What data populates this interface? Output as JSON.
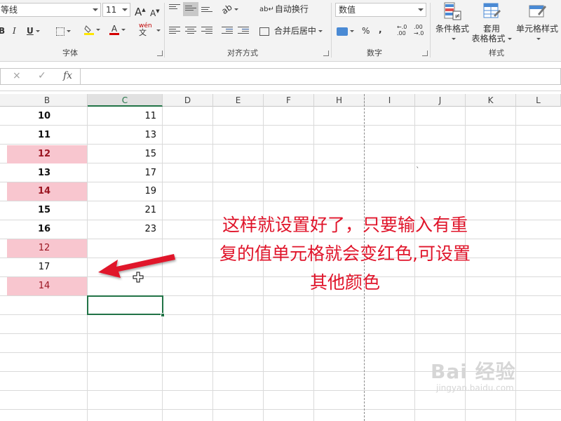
{
  "ribbon": {
    "font_group": {
      "font_name": "等线",
      "font_size": "11",
      "grow_label": "A",
      "shrink_label": "A",
      "bold_label": "B",
      "italic_label": "I",
      "underline_label": "U",
      "phonetic_label": "wén",
      "font_color_label": "A",
      "group_label": "字体"
    },
    "align_group": {
      "wrap_text_label": "自动换行",
      "merge_center_label": "合并后居中",
      "group_label": "对齐方式"
    },
    "number_group": {
      "format_value": "数值",
      "percent_label": "%",
      "comma_label": ",",
      "increase_decimal_label": "←.0 .00",
      "decrease_decimal_label": ".00 →.0",
      "group_label": "数字"
    },
    "styles_group": {
      "conditional_format_label": "条件格式",
      "table_format_label_1": "套用",
      "table_format_label_2": "表格格式",
      "cell_styles_label": "单元格样式",
      "group_label": "样式"
    }
  },
  "formula_bar": {
    "cancel_icon": "×",
    "enter_icon": "✓",
    "fx_label": "fx",
    "value": ""
  },
  "columns": [
    "B",
    "C",
    "D",
    "E",
    "F",
    "H",
    "I",
    "J",
    "K",
    "L"
  ],
  "selected_column": "C",
  "rows": [
    {
      "b": "10",
      "c": "11",
      "b_bold": true,
      "b_pink": false
    },
    {
      "b": "11",
      "c": "13",
      "b_bold": true,
      "b_pink": false
    },
    {
      "b": "12",
      "c": "15",
      "b_bold": true,
      "b_pink": true
    },
    {
      "b": "13",
      "c": "17",
      "b_bold": true,
      "b_pink": false
    },
    {
      "b": "14",
      "c": "19",
      "b_bold": true,
      "b_pink": true
    },
    {
      "b": "15",
      "c": "21",
      "b_bold": true,
      "b_pink": false
    },
    {
      "b": "16",
      "c": "23",
      "b_bold": true,
      "b_pink": false
    },
    {
      "b": "12",
      "c": "",
      "b_bold": false,
      "b_pink": true
    },
    {
      "b": "17",
      "c": "",
      "b_bold": false,
      "b_pink": false
    },
    {
      "b": "14",
      "c": "",
      "b_bold": false,
      "b_pink": true
    }
  ],
  "stray_mark": "`",
  "annotation": {
    "line1": "这样就设置好了，只要输入有重",
    "line2": "复的值单元格就会变红色,可设置",
    "line3": "其他颜色",
    "color": "#e0142a"
  },
  "colors": {
    "excel_green": "#217346",
    "duplicate_fill": "#f8c6cf",
    "duplicate_text": "#9b1622",
    "arrow_red": "#e0142a"
  },
  "watermark": {
    "main": "Bai 经验",
    "sub": "jingyan.baidu.com"
  }
}
